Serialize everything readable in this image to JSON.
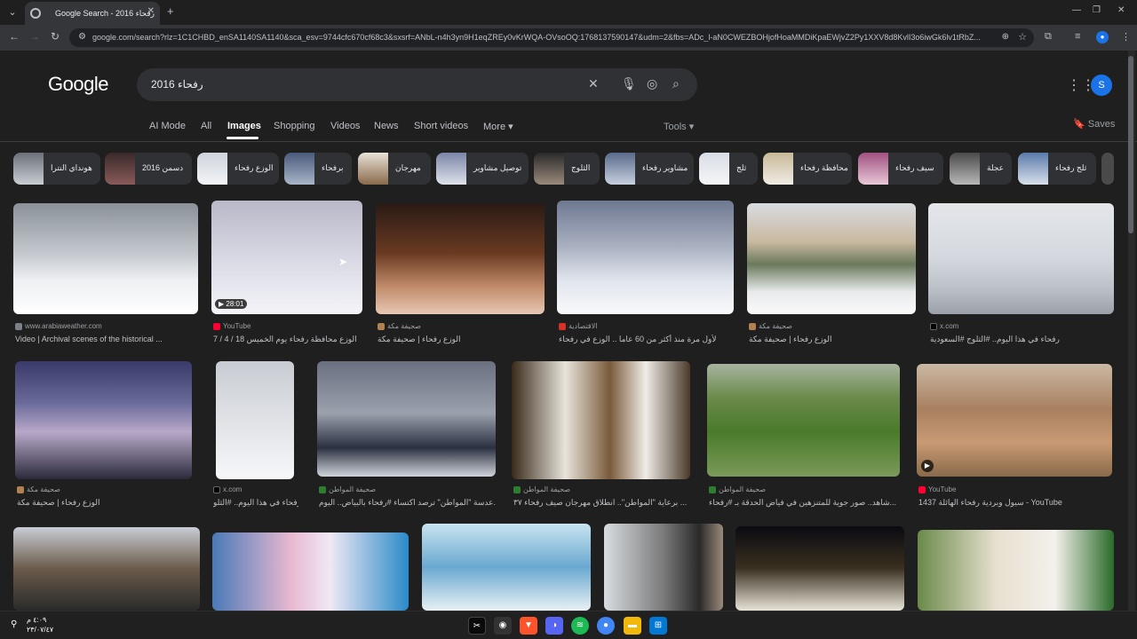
{
  "browser": {
    "tab_title": "Google Search - رفحاء 2016",
    "url": "google.com/search?rlz=1C1CHBD_enSA1140SA1140&sca_esv=9744cfc670cf68c3&sxsrf=ANbL-n4h3yn9H1eqZREy0vKrWQA-OVsoOQ:1768137590147&udm=2&fbs=ADc_l-aN0CWEZBOHjofHoaMMDiKpaEWjvZ2Py1XXV8d8KvlI3o6iwGk6lv1tRbZ..."
  },
  "google": {
    "logo": "Google",
    "query": "رفحاء 2016",
    "avatar_letter": "S",
    "tabs": [
      {
        "label": "AI Mode"
      },
      {
        "label": "All"
      },
      {
        "label": "Images"
      },
      {
        "label": "Shopping"
      },
      {
        "label": "Videos"
      },
      {
        "label": "News"
      },
      {
        "label": "Short videos"
      },
      {
        "label": "More ▾"
      }
    ],
    "tools_label": "Tools ▾",
    "saves_label": "Saves"
  },
  "chips": [
    {
      "label": "هونداي النترا"
    },
    {
      "label": "دسمن 2016"
    },
    {
      "label": "الوزع رفحاء"
    },
    {
      "label": "برفحاء"
    },
    {
      "label": "مهرجان"
    },
    {
      "label": "توصيل مشاوير"
    },
    {
      "label": "الثلوج"
    },
    {
      "label": "مشاوير رفحاء"
    },
    {
      "label": "ثلج"
    },
    {
      "label": "محافظة رفحاء"
    },
    {
      "label": "سيف رفحاء"
    },
    {
      "label": "عجلة"
    },
    {
      "label": "ثلج رفحاء"
    }
  ],
  "results": [
    {
      "source": "www.arabiaweather.com",
      "title": "Video | Archival scenes of the historical ..."
    },
    {
      "source": "YouTube",
      "title": "الوزع محافظة رفحاء يوم الخميس 18 / 4 / 7",
      "duration": "28:01"
    },
    {
      "source": "صحيفة مكة",
      "title": "الوزع رفحاء | صحيفة مكة"
    },
    {
      "source": "الاقتصادية",
      "title": "لأول مرة منذ أكثر من 60 عاما .. الوزع في رفحاء"
    },
    {
      "source": "صحيفة مكة",
      "title": "الوزع رفحاء | صحيفة مكة"
    },
    {
      "source": "x.com",
      "title": "رفحاء في هذا اليوم.. #الثلوج #السعودية"
    },
    {
      "source": "صحيفة مكة",
      "title": "الوزع رفحاء | صحيفة مكة"
    },
    {
      "source": "x.com",
      "title": "رفحاء في هذا اليوم.. #الثلو..."
    },
    {
      "source": "صحيفة المواطن",
      "title": "عدسة \"المواطن\" ترصد اكتساء #رفحاء بالبياض.. اليوم..."
    },
    {
      "source": "صحيفة المواطن",
      "title": "برعاية \"المواطن\".. انطلاق مهرجان صيف رفحاء ٣٧ ..."
    },
    {
      "source": "صحيفة المواطن",
      "title": "شاهد.. صور جوية للمتنزهين في فياض الحدقة بـ #رفحاء..."
    },
    {
      "source": "YouTube",
      "title": "سيول وبردية رفحاء الهائلة 1437 - YouTube"
    }
  ],
  "taskbar": {
    "time": "٤:٠٩ م",
    "date": "٢٣/٠٧/٤٧"
  },
  "colors": {
    "background": "#1f1f1f",
    "surface": "#303134",
    "text": "#e8eaed",
    "muted": "#9aa0a6",
    "accent": "#1a73e8"
  }
}
